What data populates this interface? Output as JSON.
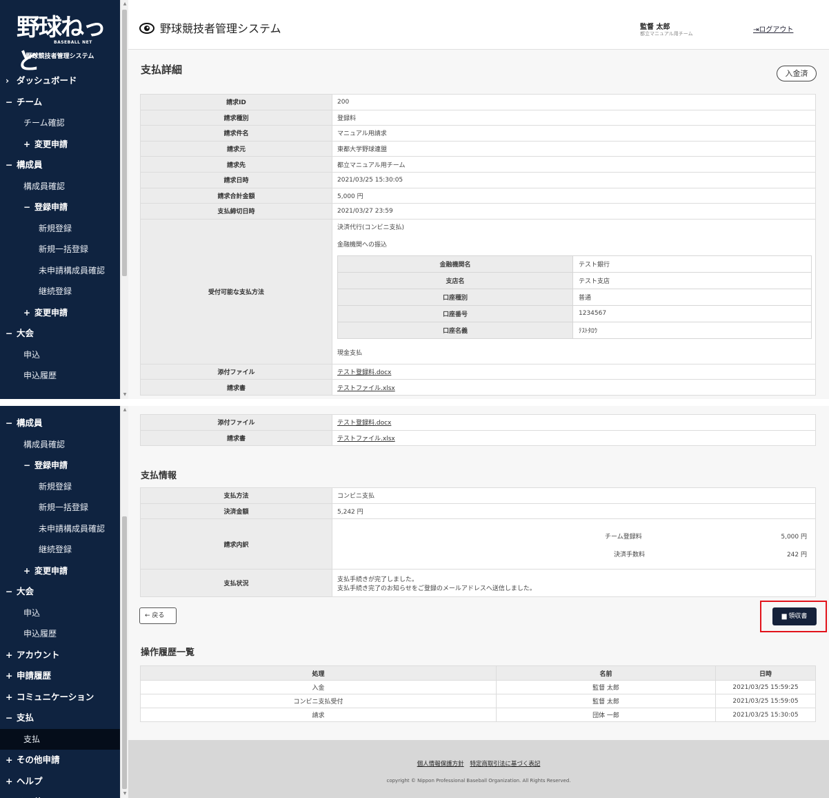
{
  "app": {
    "logo_text": "野球ねっと",
    "logo_sub": "BASEBALL NET",
    "system_name": "野球競技者管理システム",
    "title": "野球競技者管理システム",
    "user_name": "監督 太郎",
    "user_team": "都立マニュアル用チーム",
    "logout_label": "ログアウト"
  },
  "sidebar_top": [
    {
      "mark": "›",
      "label": "ダッシュボード",
      "level": 0
    },
    {
      "mark": "−",
      "label": "チーム",
      "level": 0
    },
    {
      "mark": "",
      "label": "チーム確認",
      "level": 1
    },
    {
      "mark": "+",
      "label": "変更申請",
      "level": "1b"
    },
    {
      "mark": "−",
      "label": "構成員",
      "level": 0
    },
    {
      "mark": "",
      "label": "構成員確認",
      "level": 1
    },
    {
      "mark": "−",
      "label": "登録申請",
      "level": "1b"
    },
    {
      "mark": "",
      "label": "新規登録",
      "level": 2
    },
    {
      "mark": "",
      "label": "新規一括登録",
      "level": 2
    },
    {
      "mark": "",
      "label": "未申請構成員確認",
      "level": 2
    },
    {
      "mark": "",
      "label": "継続登録",
      "level": 2
    },
    {
      "mark": "+",
      "label": "変更申請",
      "level": "1b"
    },
    {
      "mark": "−",
      "label": "大会",
      "level": 0
    },
    {
      "mark": "",
      "label": "申込",
      "level": 1
    },
    {
      "mark": "",
      "label": "申込履歴",
      "level": 1
    }
  ],
  "sidebar_bottom": [
    {
      "mark": "−",
      "label": "構成員",
      "level": 0
    },
    {
      "mark": "",
      "label": "構成員確認",
      "level": 1
    },
    {
      "mark": "−",
      "label": "登録申請",
      "level": "1b"
    },
    {
      "mark": "",
      "label": "新規登録",
      "level": 2
    },
    {
      "mark": "",
      "label": "新規一括登録",
      "level": 2
    },
    {
      "mark": "",
      "label": "未申請構成員確認",
      "level": 2
    },
    {
      "mark": "",
      "label": "継続登録",
      "level": 2
    },
    {
      "mark": "+",
      "label": "変更申請",
      "level": "1b"
    },
    {
      "mark": "−",
      "label": "大会",
      "level": 0
    },
    {
      "mark": "",
      "label": "申込",
      "level": 1
    },
    {
      "mark": "",
      "label": "申込履歴",
      "level": 1
    },
    {
      "mark": "+",
      "label": "アカウント",
      "level": 0
    },
    {
      "mark": "+",
      "label": "申請履歴",
      "level": 0
    },
    {
      "mark": "+",
      "label": "コミュニケーション",
      "level": 0
    },
    {
      "mark": "−",
      "label": "支払",
      "level": 0
    },
    {
      "mark": "",
      "label": "支払",
      "level": 1,
      "active": true
    },
    {
      "mark": "+",
      "label": "その他申請",
      "level": 0
    },
    {
      "mark": "+",
      "label": "ヘルプ",
      "level": 0
    },
    {
      "mark": "+",
      "label": "その他",
      "level": 0
    }
  ],
  "detail": {
    "title": "支払詳細",
    "status": "入金済",
    "rows": [
      {
        "label": "請求ID",
        "value": "200"
      },
      {
        "label": "請求種別",
        "value": "登録料"
      },
      {
        "label": "請求件名",
        "value": "マニュアル用請求"
      },
      {
        "label": "請求元",
        "value": "東都大学野球連盟"
      },
      {
        "label": "請求先",
        "value": "都立マニュアル用チーム"
      },
      {
        "label": "請求日時",
        "value": "2021/03/25 15:30:05"
      },
      {
        "label": "請求合計金額",
        "value": "5,000 円"
      },
      {
        "label": "支払締切日時",
        "value": "2021/03/27 23:59"
      }
    ],
    "methods_label": "受付可能な支払方法",
    "method_conv": "決済代行(コンビニ支払)",
    "method_bank": "金融機関への振込",
    "bank": [
      {
        "label": "金融機関名",
        "value": "テスト銀行"
      },
      {
        "label": "支店名",
        "value": "テスト支店"
      },
      {
        "label": "口座種別",
        "value": "普通"
      },
      {
        "label": "口座番号",
        "value": "1234567"
      },
      {
        "label": "口座名義",
        "value": "ﾃｽﾄﾀﾛｳ"
      }
    ],
    "method_cash": "現金支払",
    "attachment_label": "添付ファイル",
    "attachment_file": "テスト登録料.docx",
    "invoice_label": "請求書",
    "invoice_file": "テストファイル.xlsx"
  },
  "payment": {
    "title": "支払情報",
    "method_label": "支払方法",
    "method_value": "コンビニ支払",
    "amount_label": "決済金額",
    "amount_value": "5,242 円",
    "breakdown_label": "請求内訳",
    "breakdown": [
      {
        "name": "チーム登録料",
        "amount": "5,000 円"
      },
      {
        "name": "決済手数料",
        "amount": "242 円"
      }
    ],
    "status_label": "支払状況",
    "status_line1": "支払手続きが完了しました。",
    "status_line2": "支払手続き完了のお知らせをご登録のメールアドレスへ送信しました。",
    "back_label": "戻る",
    "receipt_label": "領収書"
  },
  "history": {
    "title": "操作履歴一覧",
    "columns": [
      "処理",
      "名前",
      "日時"
    ],
    "rows": [
      [
        "入金",
        "監督 太郎",
        "2021/03/25 15:59:25"
      ],
      [
        "コンビニ支払受付",
        "監督 太郎",
        "2021/03/25 15:59:05"
      ],
      [
        "請求",
        "団体 一郎",
        "2021/03/25 15:30:05"
      ]
    ]
  },
  "footer": {
    "privacy": "個人情報保護方針",
    "commerce": "特定商取引法に基づく表記",
    "copyright": "copyright © Nippon Professional Baseball Organization. All Rights Reserved."
  }
}
